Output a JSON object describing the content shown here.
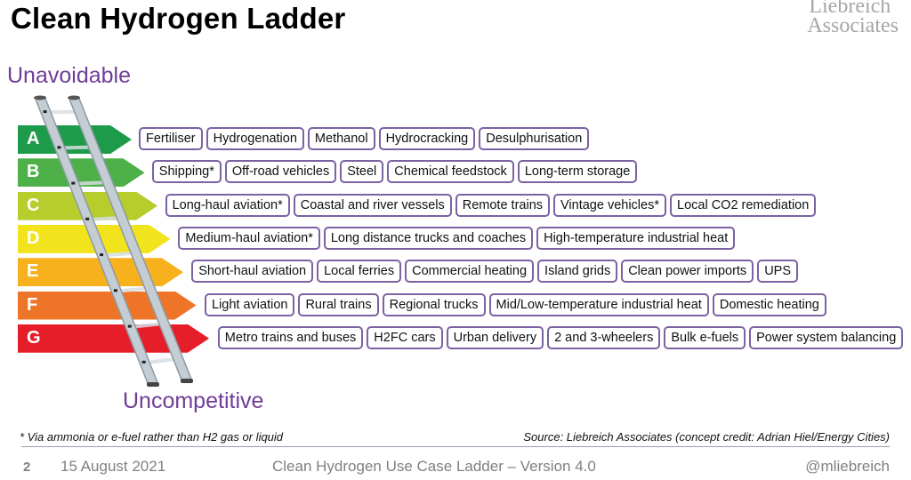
{
  "title": "Clean Hydrogen Ladder",
  "logo": {
    "line1": "Liebreich",
    "line2": "Associates"
  },
  "axis_labels": {
    "top": "Unavoidable",
    "bottom": "Uncompetitive"
  },
  "bands": [
    {
      "letter": "A",
      "color": "#1e9b4a",
      "items": [
        "Fertiliser",
        "Hydrogenation",
        "Methanol",
        "Hydrocracking",
        "Desulphurisation"
      ]
    },
    {
      "letter": "B",
      "color": "#4db049",
      "items": [
        "Shipping*",
        "Off-road vehicles",
        "Steel",
        "Chemical feedstock",
        "Long-term storage"
      ]
    },
    {
      "letter": "C",
      "color": "#b6cd2c",
      "items": [
        "Long-haul aviation*",
        "Coastal and river vessels",
        "Remote trains",
        "Vintage vehicles*",
        "Local CO2 remediation"
      ]
    },
    {
      "letter": "D",
      "color": "#f1e41c",
      "items": [
        "Medium-haul aviation*",
        "Long distance trucks and coaches",
        "High-temperature industrial heat"
      ]
    },
    {
      "letter": "E",
      "color": "#f6b11d",
      "items": [
        "Short-haul aviation",
        "Local ferries",
        "Commercial heating",
        "Island grids",
        "Clean power imports",
        "UPS"
      ]
    },
    {
      "letter": "F",
      "color": "#ee7428",
      "items": [
        "Light aviation",
        "Rural trains",
        "Regional trucks",
        "Mid/Low-temperature industrial heat",
        "Domestic heating"
      ]
    },
    {
      "letter": "G",
      "color": "#e61e2a",
      "items": [
        "Metro trains and buses",
        "H2FC cars",
        "Urban delivery",
        "2 and 3-wheelers",
        "Bulk e-fuels",
        "Power system balancing"
      ]
    }
  ],
  "chip_border_color": "#7a62a3",
  "footnote": "* Via ammonia or e-fuel rather than H2 gas or liquid",
  "source": "Source: Liebreich Associates (concept credit: Adrian Hiel/Energy Cities)",
  "footer": {
    "page": "2",
    "date": "15 August 2021",
    "deck_title": "Clean Hydrogen Use Case Ladder – Version 4.0",
    "handle": "@mliebreich"
  }
}
